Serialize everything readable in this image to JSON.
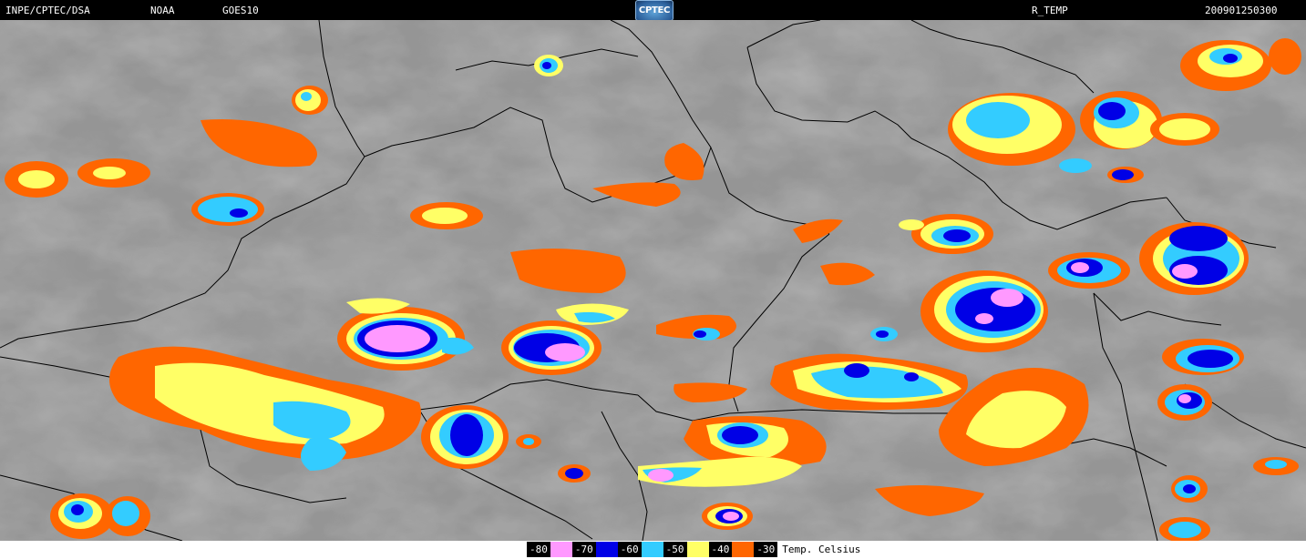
{
  "header": {
    "institute": "INPE/CPTEC/DSA",
    "agency": "NOAA",
    "satellite": "GOES10",
    "logo_text": "CPTEC",
    "product": "R_TEMP",
    "timestamp": "200901250300"
  },
  "legend": {
    "entries": [
      {
        "label": "-80",
        "color": "#ff99ff"
      },
      {
        "label": "-70",
        "color": "#0000e6"
      },
      {
        "label": "-60",
        "color": "#33ccff"
      },
      {
        "label": "-50",
        "color": "#ffff66"
      },
      {
        "label": "-40",
        "color": "#ff6600"
      },
      {
        "label": "-30",
        "color": "#ff6600"
      }
    ],
    "caption": "Temp. Celsius"
  },
  "palette": {
    "background_gray": "#808080",
    "border_line": "#000000"
  }
}
